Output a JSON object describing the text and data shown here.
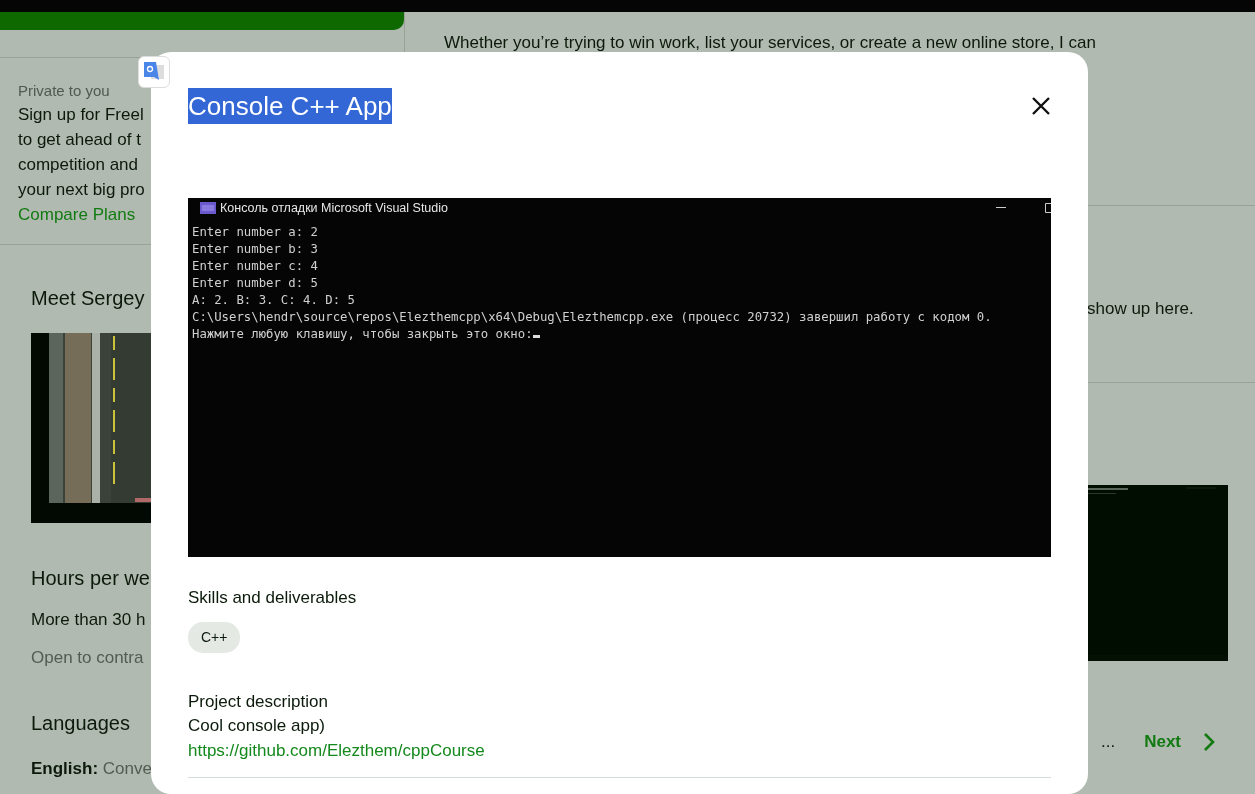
{
  "background": {
    "intro_text": "Whether you’re trying to win work, list your services, or create a new online store, I can",
    "promo": {
      "label": "Private to you",
      "lines": [
        "Sign up for Freel",
        "to get ahead of t",
        "competition and",
        "your next big pro"
      ],
      "link": "Compare Plans"
    },
    "profile": {
      "heading": "Meet Sergey",
      "hours_heading": "Hours per we",
      "hours_value": "More than 30 h",
      "contract_note": "Open to contra",
      "languages_heading": "Languages",
      "language": {
        "name": "English:",
        "level": "Conve"
      }
    },
    "empty_note": "show up here.",
    "pagination": {
      "ellipsis": "...",
      "next": "Next"
    }
  },
  "modal": {
    "title": "Console C++ App",
    "title_selected": true,
    "console": {
      "title": "Консоль отладки Microsoft Visual Studio",
      "lines": [
        "Enter number a: 2",
        "Enter number b: 3",
        "Enter number c: 4",
        "Enter number d: 5",
        "A: 2. B: 3. C: 4. D: 5",
        "C:\\Users\\hendr\\source\\repos\\Elezthemcpp\\x64\\Debug\\Elezthemcpp.exe (процесс 20732) завершил работу с кодом 0.",
        "Нажмите любую клавишу, чтобы закрыть это окно:"
      ],
      "cursor": true
    },
    "skills_heading": "Skills and deliverables",
    "skills": [
      "C++"
    ],
    "description_heading": "Project description",
    "description": "Cool console app)",
    "link": "https://github.com/Elezthem/cppCourse"
  }
}
